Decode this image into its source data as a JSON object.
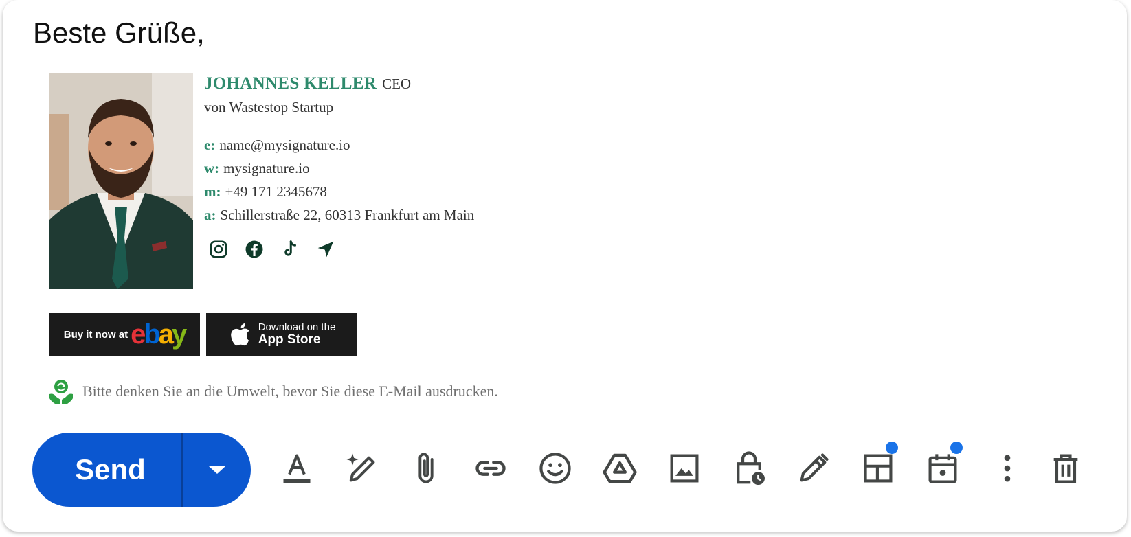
{
  "greeting": "Beste Grüße,",
  "signature": {
    "name": "JOHANNES KELLER",
    "title": "CEO",
    "company": "von Wastestop Startup",
    "contacts": [
      {
        "key": "e:",
        "value": "name@mysignature.io"
      },
      {
        "key": "w:",
        "value": "mysignature.io"
      },
      {
        "key": "m:",
        "value": "+49 171 2345678"
      },
      {
        "key": "a:",
        "value": "Schillerstraße 22, 60313 Frankfurt am Main"
      }
    ],
    "socials": [
      "instagram-icon",
      "facebook-icon",
      "tiktok-icon",
      "location-arrow-icon"
    ]
  },
  "badges": {
    "ebay": {
      "text": "Buy it now at",
      "logo": "ebay"
    },
    "appstore": {
      "small": "Download on the",
      "big": "App Store"
    }
  },
  "eco_note": "Bitte denken Sie an die Umwelt, bevor Sie diese E-Mail ausdrucken.",
  "toolbar": {
    "send_label": "Send",
    "icons": [
      "text-format-icon",
      "ai-write-icon",
      "attach-icon",
      "link-icon",
      "emoji-icon",
      "drive-icon",
      "image-icon",
      "confidential-mode-icon",
      "signature-pen-icon",
      "layout-template-icon",
      "schedule-event-icon",
      "more-options-icon",
      "delete-icon"
    ]
  },
  "colors": {
    "accent_green": "#2e8a6c",
    "icon_dark_green": "#0f3b2a",
    "send_blue": "#0b57d0",
    "notification_blue": "#1a73e8"
  }
}
